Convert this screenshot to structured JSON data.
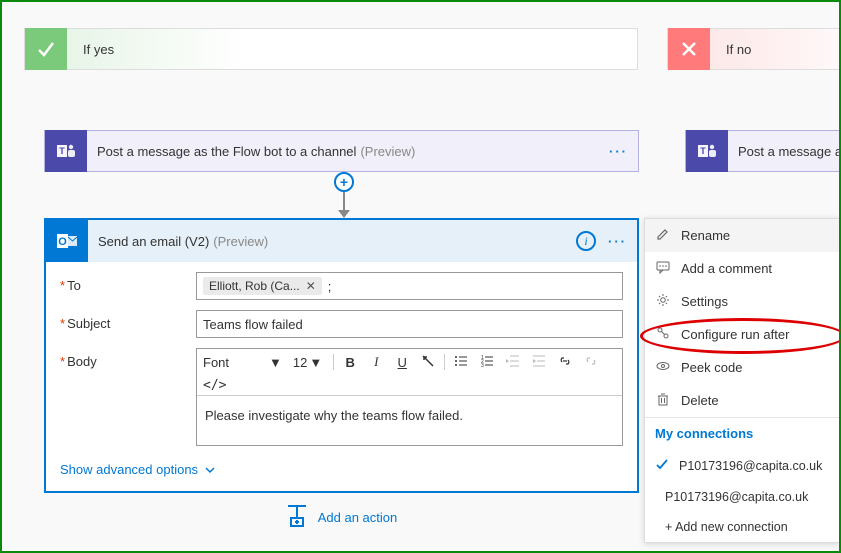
{
  "branch": {
    "yes_label": "If yes",
    "no_label": "If no"
  },
  "teams_card": {
    "title": "Post a message as the Flow bot to a channel",
    "preview": "(Preview)",
    "title_right": "Post a message a"
  },
  "email_card": {
    "title": "Send an email (V2)",
    "preview": "(Preview)",
    "fields": {
      "to_label": "To",
      "to_token": "Elliott, Rob (Ca...",
      "subject_label": "Subject",
      "subject_value": "Teams flow failed",
      "body_label": "Body",
      "font_label": "Font",
      "font_size": "12",
      "body_value": "Please investigate why the teams flow failed."
    },
    "advanced_link": "Show advanced options"
  },
  "menu": {
    "rename": "Rename",
    "comment": "Add a comment",
    "settings": "Settings",
    "configure": "Configure run after",
    "peek": "Peek code",
    "delete": "Delete",
    "connections_header": "My connections",
    "conn1": "P10173196@capita.co.uk",
    "conn2": "P10173196@capita.co.uk",
    "add_conn": "+ Add new connection"
  },
  "add_action": {
    "label": "Add an action"
  }
}
